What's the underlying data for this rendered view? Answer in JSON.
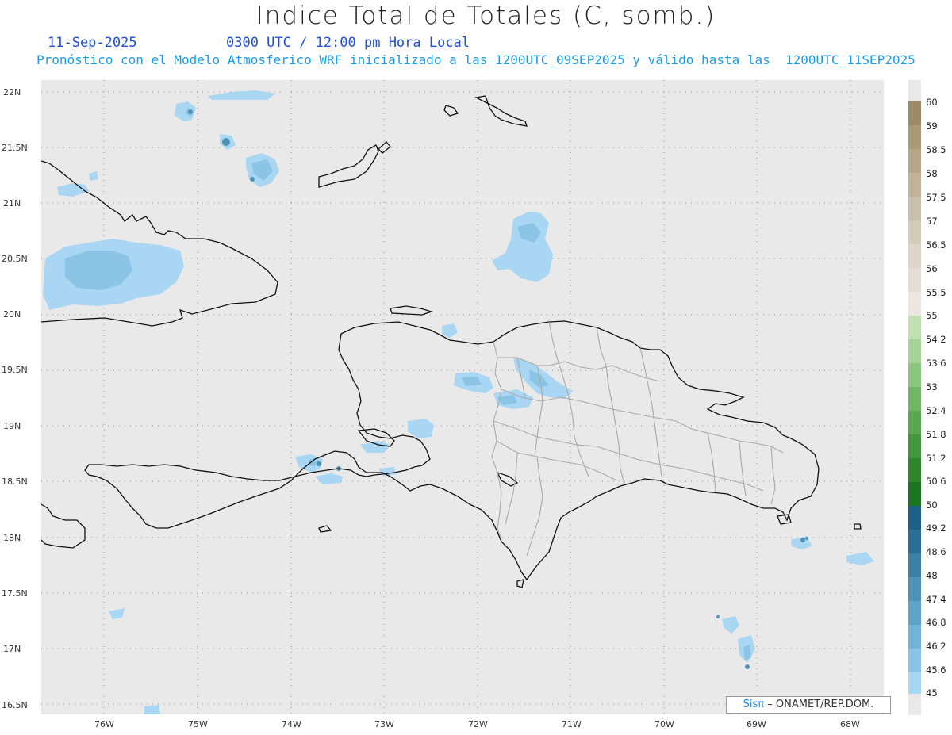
{
  "header": {
    "title": "Indice Total de Totales (C, somb.)",
    "date": "11-Sep-2025",
    "time_info": "0300 UTC / 12:00 pm Hora Local",
    "model_info": "Pronóstico con el Modelo Atmosferico WRF inicializado a las 1200UTC_09SEP2025 y válido hasta las  1200UTC_11SEP2025"
  },
  "map": {
    "lat_labels": [
      "22N",
      "21.5N",
      "21N",
      "20.5N",
      "20N",
      "19.5N",
      "19N",
      "18.5N",
      "18N",
      "17.5N",
      "17N",
      "16.5N"
    ],
    "lon_labels": [
      "76W",
      "75W",
      "74W",
      "73W",
      "72W",
      "71W",
      "70W",
      "69W",
      "68W"
    ],
    "background_color": "#e9e9e9",
    "coastline_color": "#111111",
    "province_border_color": "#a8a8a8"
  },
  "colorbar": {
    "labels": [
      "60",
      "59",
      "58.5",
      "58",
      "57.5",
      "57",
      "56.5",
      "56",
      "55.5",
      "55",
      "54.2",
      "53.6",
      "53",
      "52.4",
      "51.8",
      "51.2",
      "50.6",
      "50",
      "49.2",
      "48.6",
      "48",
      "47.4",
      "46.8",
      "46.2",
      "45.6",
      "45"
    ],
    "colors": [
      "#e8e8e8",
      "#9c8a66",
      "#ab9a77",
      "#b7a688",
      "#c1b299",
      "#cabfaa",
      "#d5cbba",
      "#ddd5c8",
      "#e4ddd3",
      "#ebe7e0",
      "#bfe0b2",
      "#a7d39a",
      "#8cc57f",
      "#71b566",
      "#5aa651",
      "#43963d",
      "#2f852e",
      "#1a7420",
      "#1d5f86",
      "#2c6f96",
      "#3c80a6",
      "#4d91b7",
      "#5fa3c8",
      "#73b3d8",
      "#8cc4e6",
      "#a9d6f2",
      "#e8e8e8"
    ]
  },
  "credit": {
    "brand": "Sisπ",
    "text": "– ONAMET/REP.DOM."
  }
}
